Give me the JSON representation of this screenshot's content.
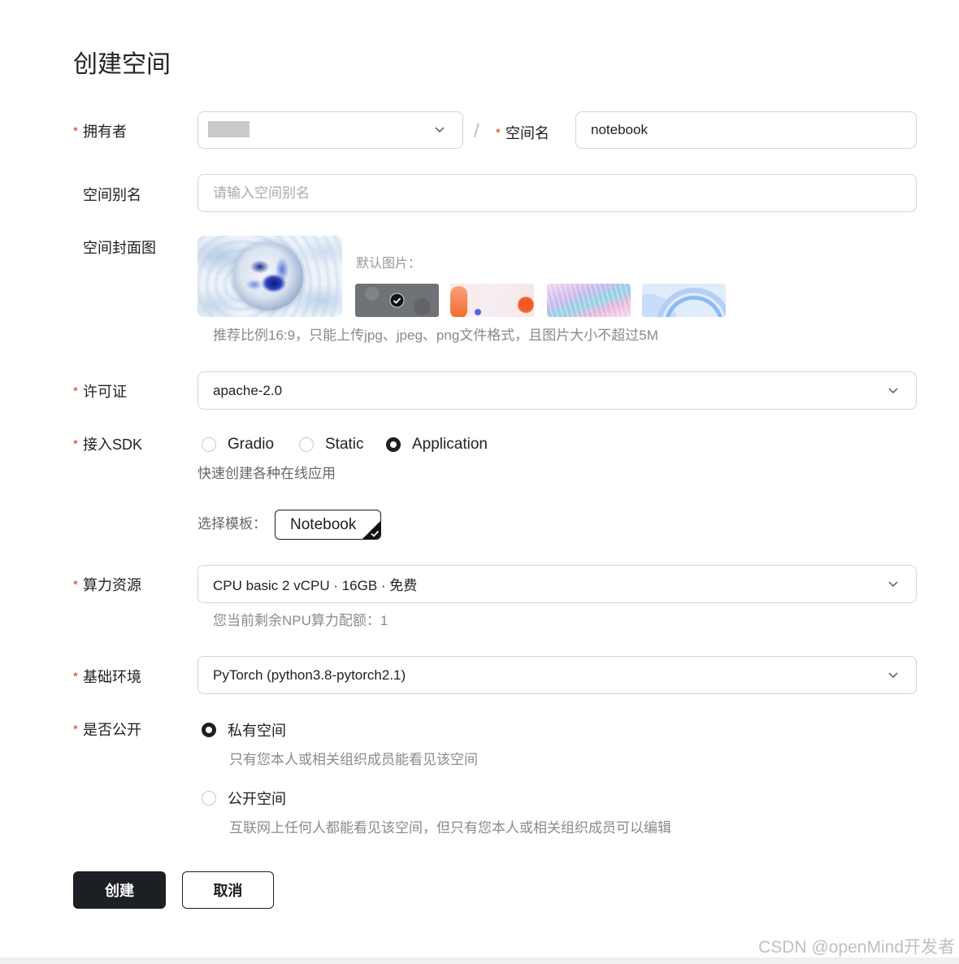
{
  "page": {
    "title": "创建空间"
  },
  "required_mark": "*",
  "colors": {
    "primary": "#1c1f23",
    "required": "#e0301e"
  },
  "form": {
    "owner": {
      "label": "拥有者",
      "icon": "chevron-down-icon"
    },
    "separator": "/",
    "space_name": {
      "label": "空间名",
      "value": "notebook"
    },
    "alias": {
      "label": "空间别名",
      "placeholder": "请输入空间别名",
      "value": ""
    },
    "cover": {
      "label": "空间封面图",
      "default_label": "默认图片：",
      "thumbnails": [
        {
          "selected": true
        },
        {
          "selected": false
        },
        {
          "selected": false
        },
        {
          "selected": false
        }
      ],
      "hint": "推荐比例16:9，只能上传jpg、jpeg、png文件格式，且图片大小不超过5M"
    },
    "license": {
      "label": "许可证",
      "value": "apache-2.0",
      "icon": "chevron-down-icon"
    },
    "sdk": {
      "label": "接入SDK",
      "options": [
        {
          "label": "Gradio",
          "selected": false
        },
        {
          "label": "Static",
          "selected": false
        },
        {
          "label": "Application",
          "selected": true
        }
      ],
      "description": "快速创建各种在线应用",
      "template_label": "选择模板：",
      "template_value": "Notebook"
    },
    "compute": {
      "label": "算力资源",
      "value": "CPU basic 2 vCPU · 16GB · 免费",
      "quota_text": "您当前剩余NPU算力配额：1",
      "icon": "chevron-down-icon"
    },
    "env": {
      "label": "基础环境",
      "value": "PyTorch (python3.8-pytorch2.1)",
      "icon": "chevron-down-icon"
    },
    "visibility": {
      "label": "是否公开",
      "options": [
        {
          "label": "私有空间",
          "description": "只有您本人或相关组织成员能看见该空间",
          "selected": true
        },
        {
          "label": "公开空间",
          "description": "互联网上任何人都能看见该空间，但只有您本人或相关组织成员可以编辑",
          "selected": false
        }
      ]
    }
  },
  "actions": {
    "create_label": "创建",
    "cancel_label": "取消"
  },
  "watermark": "CSDN @openMind开发者"
}
